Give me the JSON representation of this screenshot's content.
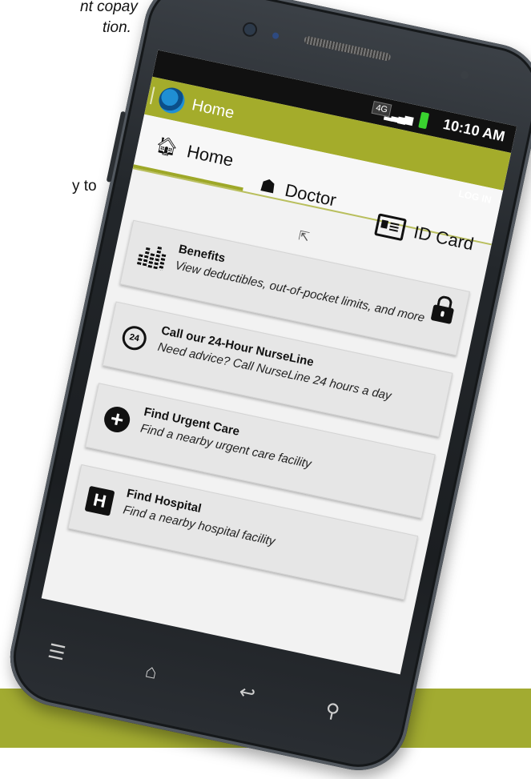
{
  "page": {
    "caption_line1": "nt copay",
    "caption_line2": "tion.",
    "caption_mid": "y to"
  },
  "colors": {
    "accent": "#a4ac2b",
    "band": "#a2ab31"
  },
  "status_bar": {
    "network": "4G",
    "time": "10:10 AM"
  },
  "app": {
    "title": "Home",
    "login": "LOG IN"
  },
  "tabs": [
    {
      "label": "Home",
      "icon": "home-icon"
    },
    {
      "label": "Doctor",
      "icon": "doctor-icon"
    },
    {
      "label": "ID Card",
      "icon": "id-card-icon"
    }
  ],
  "items": [
    {
      "title": "Benefits",
      "desc": "View deductibles, out-of-pocket limits, and more",
      "icon": "benefits-bars-icon",
      "locked": true
    },
    {
      "title": "Call our 24-Hour NurseLine",
      "desc": "Need advice? Call NurseLine 24 hours a day",
      "icon": "phone-24-icon"
    },
    {
      "title": "Find Urgent Care",
      "desc": "Find a nearby urgent care facility",
      "icon": "plus-circle-icon"
    },
    {
      "title": "Find Hospital",
      "desc": "Find a nearby hospital facility",
      "icon": "hospital-icon"
    }
  ]
}
